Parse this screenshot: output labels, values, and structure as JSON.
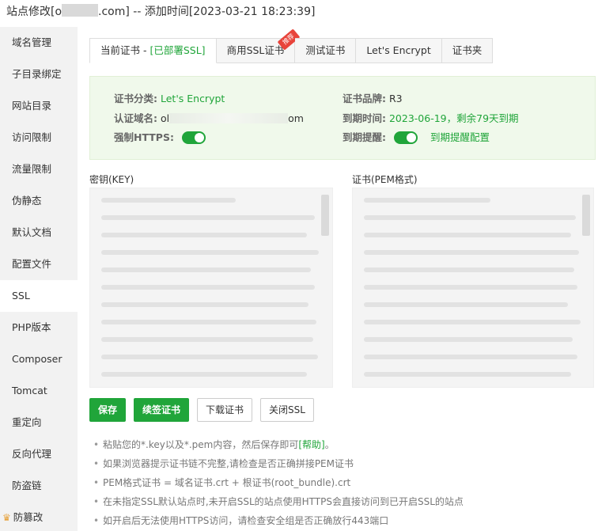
{
  "title": {
    "prefix": "站点修改[o",
    "suffix": ".com] -- 添加时间[2023-03-21 18:23:39]"
  },
  "sidebar": {
    "items": [
      {
        "label": "域名管理"
      },
      {
        "label": "子目录绑定"
      },
      {
        "label": "网站目录"
      },
      {
        "label": "访问限制"
      },
      {
        "label": "流量限制"
      },
      {
        "label": "伪静态"
      },
      {
        "label": "默认文档"
      },
      {
        "label": "配置文件"
      },
      {
        "label": "SSL"
      },
      {
        "label": "PHP版本"
      },
      {
        "label": "Composer"
      },
      {
        "label": "Tomcat"
      },
      {
        "label": "重定向"
      },
      {
        "label": "反向代理"
      },
      {
        "label": "防盗链"
      },
      {
        "label": "防篡改"
      }
    ],
    "active": "SSL"
  },
  "tabs": {
    "current": "当前证书 - ",
    "current_status": "[已部署SSL]",
    "commercial": "商用SSL证书",
    "commercial_badge": "推荐",
    "test": "测试证书",
    "letsencrypt": "Let's Encrypt",
    "folder": "证书夹"
  },
  "cert_info": {
    "category_label": "证书分类:",
    "category_value": "Let's Encrypt",
    "brand_label": "证书品牌:",
    "brand_value": "R3",
    "domain_label": "认证域名:",
    "domain_prefix": "ol",
    "domain_suffix": "om",
    "expiry_label": "到期时间:",
    "expiry_value": "2023-06-19，剩余79天到期",
    "https_label": "强制HTTPS:",
    "reminder_label": "到期提醒:",
    "reminder_config": "到期提醒配置"
  },
  "fields": {
    "key_label": "密钥(KEY)",
    "cert_label": "证书(PEM格式)"
  },
  "buttons": {
    "save": "保存",
    "renew": "续签证书",
    "download": "下载证书",
    "close_ssl": "关闭SSL"
  },
  "tips": {
    "tip1": "粘贴您的*.key以及*.pem内容，然后保存即可",
    "tip1_link": "[帮助]",
    "tip1_end": "。",
    "tip2": "如果浏览器提示证书链不完整,请检查是否正确拼接PEM证书",
    "tip3": "PEM格式证书 = 域名证书.crt + 根证书(root_bundle).crt",
    "tip4": "在未指定SSL默认站点时,未开启SSL的站点使用HTTPS会直接访问到已开启SSL的站点",
    "tip5": "如开启后无法使用HTTPS访问，请检查安全组是否正确放行443端口"
  },
  "colors": {
    "accent": "#20a53a",
    "sidebar_bg": "#f2f2f2",
    "info_bg": "#f0f9eb",
    "badge": "#e8443b"
  }
}
